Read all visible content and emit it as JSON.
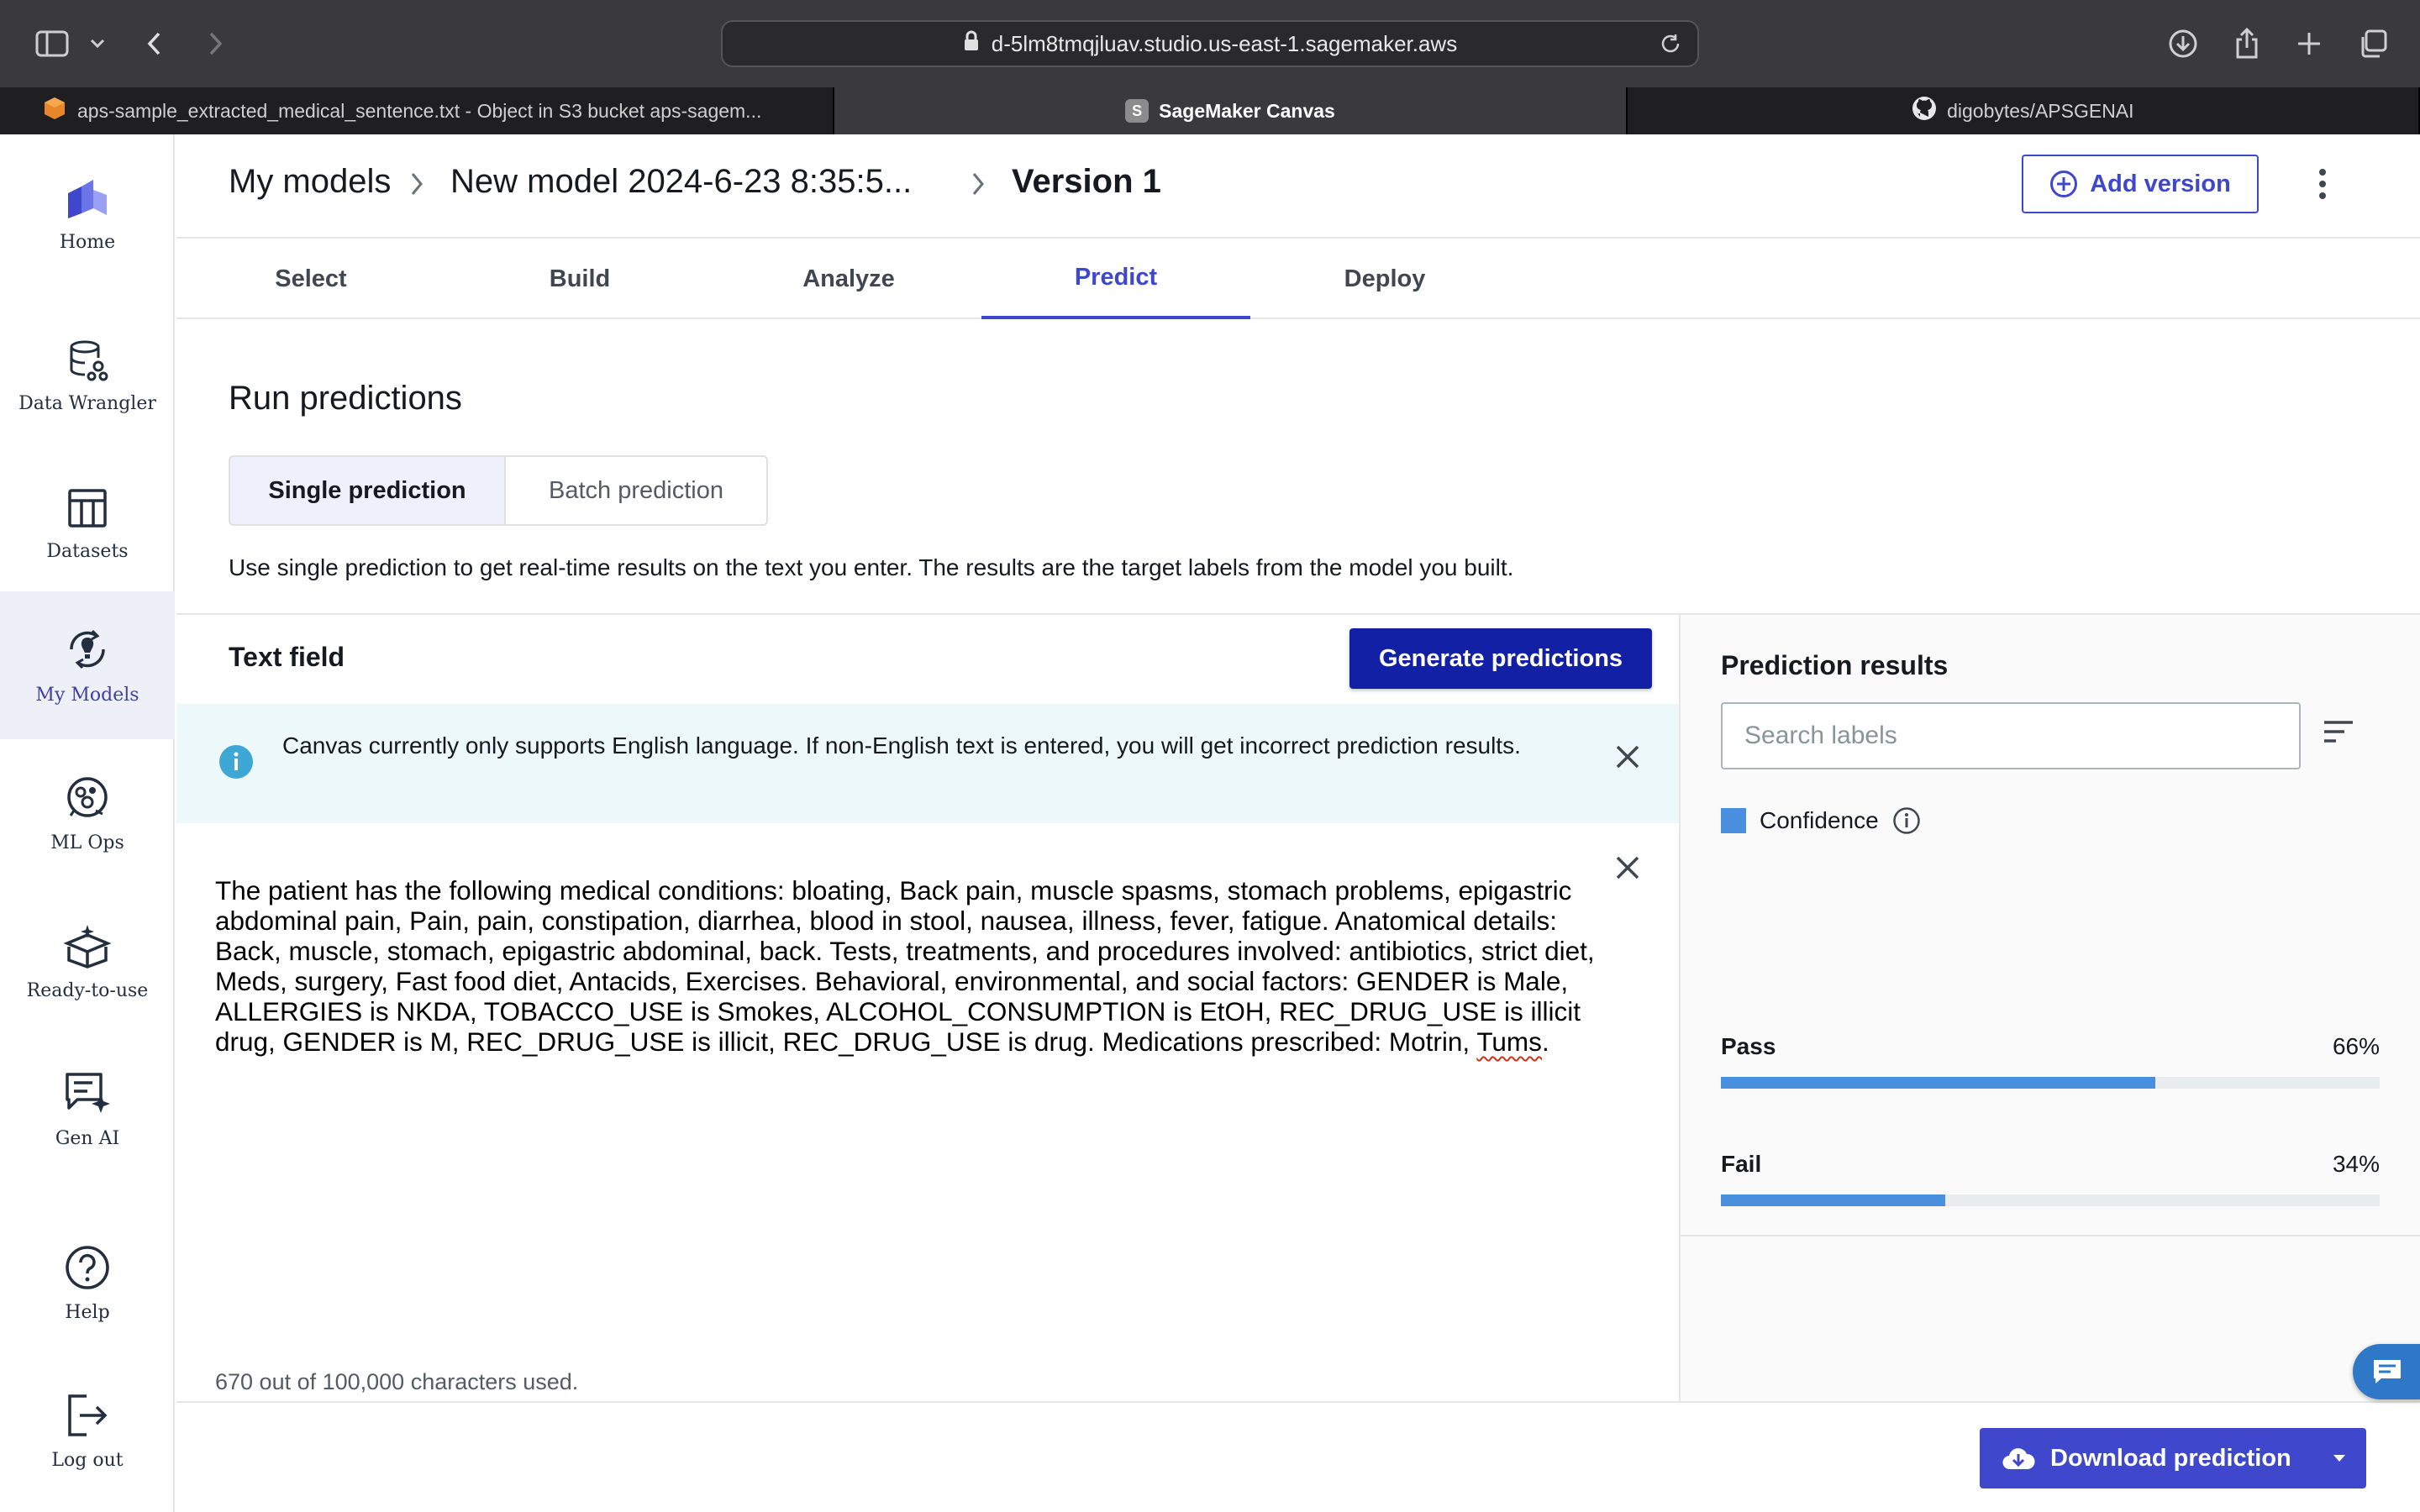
{
  "browser": {
    "url": "d-5lm8tmqjluav.studio.us-east-1.sagemaker.aws",
    "tabs": [
      {
        "label": "aps-sample_extracted_medical_sentence.txt - Object in S3 bucket aps-sagem..."
      },
      {
        "label": "SageMaker Canvas",
        "icon_letter": "S"
      },
      {
        "label": "digobytes/APSGENAI"
      }
    ]
  },
  "sidebar": {
    "items": [
      {
        "label": "Home"
      },
      {
        "label": "Data Wrangler"
      },
      {
        "label": "Datasets"
      },
      {
        "label": "My Models"
      },
      {
        "label": "ML Ops"
      },
      {
        "label": "Ready-to-use"
      },
      {
        "label": "Gen AI"
      },
      {
        "label": "Help"
      },
      {
        "label": "Log out"
      }
    ]
  },
  "breadcrumb": {
    "root": "My models",
    "model": "New model 2024-6-23 8:35:5...",
    "version": "Version 1"
  },
  "header": {
    "add_version_label": "Add version"
  },
  "steps": [
    "Select",
    "Build",
    "Analyze",
    "Predict",
    "Deploy"
  ],
  "run": {
    "title": "Run predictions",
    "single_label": "Single prediction",
    "batch_label": "Batch prediction",
    "description": "Use single prediction to get real-time results on the text you enter. The results are the target labels from the model you built."
  },
  "text_field": {
    "title": "Text field",
    "generate_label": "Generate predictions",
    "info": "Canvas currently only supports English language. If non-English text is entered, you will get incorrect prediction results.",
    "content_main": "The patient has the following medical conditions: bloating, Back pain, muscle spasms, stomach problems, epigastric abdominal pain, Pain, pain, constipation, diarrhea, blood in stool, nausea, illness, fever, fatigue. Anatomical details: Back, muscle, stomach, epigastric abdominal, back. Tests, treatments, and procedures involved: antibiotics, strict diet, Meds, surgery, Fast food diet, Antacids, Exercises. Behavioral, environmental, and social factors: GENDER is Male, ALLERGIES is NKDA, TOBACCO_USE is Smokes, ALCOHOL_CONSUMPTION is EtOH, REC_DRUG_USE is illicit drug, GENDER is M, REC_DRUG_USE is illicit, REC_DRUG_USE is drug. Medications prescribed: Motrin, ",
    "content_flagged": "Tums",
    "content_end": ".",
    "char_count": "670 out of 100,000 characters used."
  },
  "results": {
    "title": "Prediction results",
    "search_placeholder": "Search labels",
    "legend": "Confidence",
    "items": [
      {
        "label": "Pass",
        "pct": "66%",
        "value": 0.66
      },
      {
        "label": "Fail",
        "pct": "34%",
        "value": 0.34
      }
    ]
  },
  "footer": {
    "download_label": "Download prediction"
  },
  "colors": {
    "accent": "#3f48cc",
    "primary_button": "#1220a6",
    "bar": "#4a8fdd",
    "info_bg": "#ecf8fa"
  }
}
